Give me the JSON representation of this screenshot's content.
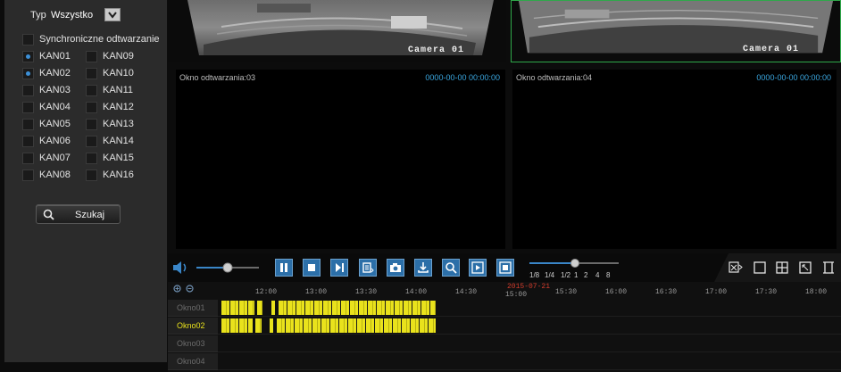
{
  "filter": {
    "label": "Typ",
    "value": "Wszystko"
  },
  "sync": {
    "label": "Synchroniczne odtwarzanie",
    "checked": false
  },
  "channels": [
    {
      "label": "KAN01",
      "checked": true
    },
    {
      "label": "KAN02",
      "checked": true
    },
    {
      "label": "KAN03",
      "checked": false
    },
    {
      "label": "KAN04",
      "checked": false
    },
    {
      "label": "KAN05",
      "checked": false
    },
    {
      "label": "KAN06",
      "checked": false
    },
    {
      "label": "KAN07",
      "checked": false
    },
    {
      "label": "KAN08",
      "checked": false
    },
    {
      "label": "KAN09",
      "checked": false
    },
    {
      "label": "KAN10",
      "checked": false
    },
    {
      "label": "KAN11",
      "checked": false
    },
    {
      "label": "KAN12",
      "checked": false
    },
    {
      "label": "KAN13",
      "checked": false
    },
    {
      "label": "KAN14",
      "checked": false
    },
    {
      "label": "KAN15",
      "checked": false
    },
    {
      "label": "KAN16",
      "checked": false
    }
  ],
  "search": {
    "label": "Szukaj"
  },
  "windows": [
    {
      "caption": "Camera 01"
    },
    {
      "caption": "Camera 01"
    },
    {
      "title": "Okno odtwarzania:03",
      "time": "0000-00-00 00:00:00"
    },
    {
      "title": "Okno odtwarzania:04",
      "time": "0000-00-00 00:00:00"
    }
  ],
  "playback": {
    "volume": 0.5,
    "speed_labels": [
      "1/8",
      "1/4",
      "1/2",
      "1",
      "2",
      "4",
      "8"
    ]
  },
  "timeline": {
    "date": "2015-07-21",
    "ticks": [
      "12:00",
      "13:00",
      "13:30",
      "14:00",
      "14:30",
      "15:00",
      "15:30",
      "16:00",
      "16:30",
      "17:00",
      "17:30",
      "18:00"
    ],
    "rows": [
      "Okno01",
      "Okno02",
      "Okno03",
      "Okno04"
    ],
    "selected_row": "Okno02"
  },
  "colors": {
    "accent": "#2c6fa8",
    "record": "#e9e21c",
    "time": "#3aa7e0",
    "date": "#d23c2c"
  }
}
